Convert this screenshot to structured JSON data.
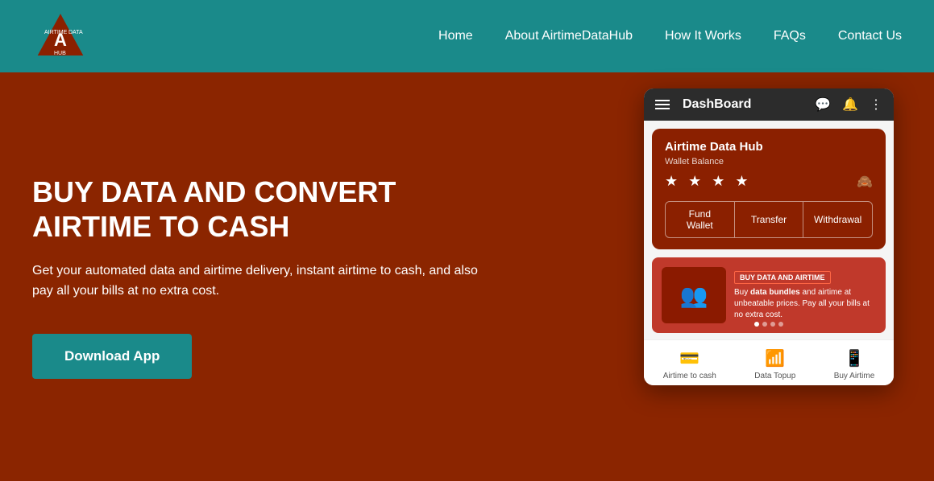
{
  "header": {
    "nav": [
      {
        "label": "Home",
        "id": "nav-home"
      },
      {
        "label": "About AirtimeDataHub",
        "id": "nav-about"
      },
      {
        "label": "How It Works",
        "id": "nav-how"
      },
      {
        "label": "FAQs",
        "id": "nav-faqs"
      },
      {
        "label": "Contact Us",
        "id": "nav-contact"
      }
    ]
  },
  "hero": {
    "title": "BUY DATA AND CONVERT AIRTIME TO CASH",
    "subtitle": "Get your automated data and airtime delivery, instant airtime to cash, and also pay all your bills at no extra cost.",
    "cta_label": "Download App"
  },
  "app": {
    "dashboard_title": "DashBoard",
    "wallet_name": "Airtime Data Hub",
    "wallet_balance_label": "Wallet Balance",
    "wallet_balance_masked": "★ ★ ★ ★",
    "fund_label": "Fund\nWallet",
    "transfer_label": "Transfer",
    "withdrawal_label": "Withdrawal",
    "banner_badge_prefix": "BUY ",
    "banner_badge_main": "DATA AND AIRTIME",
    "banner_text": "Buy data bundles and airtime at unbeatable prices. Pay all your bills at no extra cost.",
    "bottom_nav": [
      {
        "label": "Airtime to cash",
        "icon": "💳"
      },
      {
        "label": "Data Topup",
        "icon": "📶"
      },
      {
        "label": "Buy Airtime",
        "icon": "📱"
      }
    ]
  },
  "colors": {
    "header_bg": "#1a8a8a",
    "hero_bg": "#8B2500",
    "wallet_bg": "#8B2000",
    "button_bg": "#1a8a8a"
  }
}
